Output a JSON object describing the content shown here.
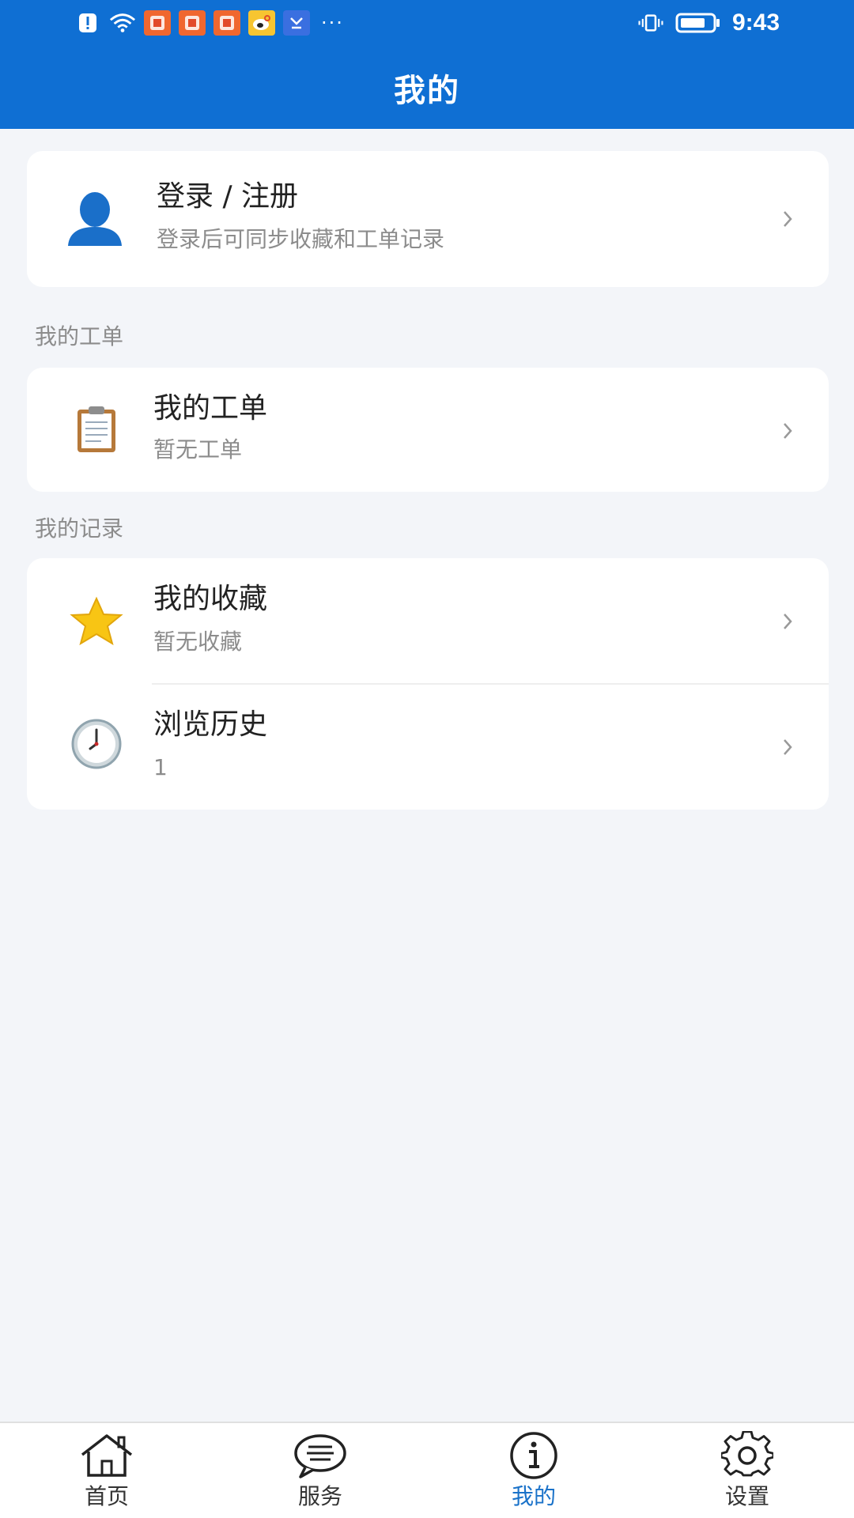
{
  "status_bar": {
    "time": "9:43",
    "icons": [
      "alert-icon",
      "wifi-icon",
      "app-icon",
      "app-icon",
      "app-icon",
      "weibo-icon",
      "app-icon",
      "more-dots-icon"
    ],
    "right_icons": [
      "vibrate-icon",
      "battery-icon"
    ]
  },
  "header": {
    "title": "我的"
  },
  "login_card": {
    "title": "登录 / 注册",
    "subtitle": "登录后可同步收藏和工单记录",
    "icon": "user-avatar-icon"
  },
  "sections": {
    "orders_label": "我的工单",
    "records_label": "我的记录"
  },
  "orders": {
    "title": "我的工单",
    "subtitle": "暂无工单",
    "icon": "clipboard-icon"
  },
  "records": [
    {
      "title": "我的收藏",
      "subtitle": "暂无收藏",
      "icon": "star-icon"
    },
    {
      "title": "浏览历史",
      "subtitle": "1",
      "icon": "clock-icon"
    }
  ],
  "tabs": [
    {
      "label": "首页",
      "icon": "home-icon",
      "active": false
    },
    {
      "label": "服务",
      "icon": "chat-bubble-icon",
      "active": false
    },
    {
      "label": "我的",
      "icon": "info-icon",
      "active": true
    },
    {
      "label": "设置",
      "icon": "gear-icon",
      "active": false
    }
  ],
  "colors": {
    "header_bg": "#0f6fd3",
    "page_bg": "#f3f5f9",
    "active_tab": "#1a72c9",
    "subtitle": "#8c8c8c"
  }
}
